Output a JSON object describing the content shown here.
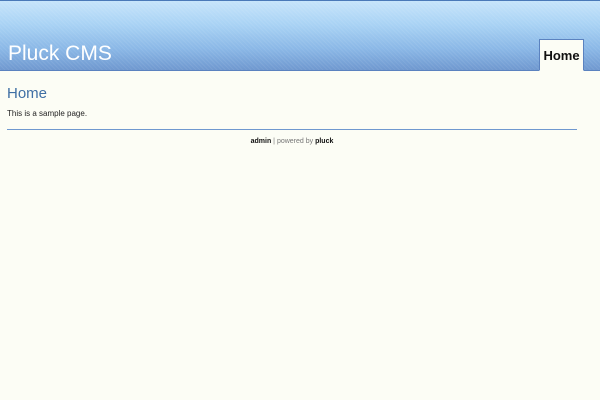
{
  "header": {
    "site_title": "Pluck CMS"
  },
  "nav": {
    "tabs": [
      {
        "label": "Home",
        "active": true
      }
    ]
  },
  "page": {
    "title": "Home",
    "body": "This is a sample page."
  },
  "footer": {
    "admin_link": "admin",
    "separator": " | powered by ",
    "pluck_link": "pluck"
  },
  "colors": {
    "page_background": "#fcfdf5",
    "header_top": "#c6e4fb",
    "header_bottom": "#6f98cf",
    "accent": "#3f6fa4",
    "divider": "#6f98cf"
  }
}
